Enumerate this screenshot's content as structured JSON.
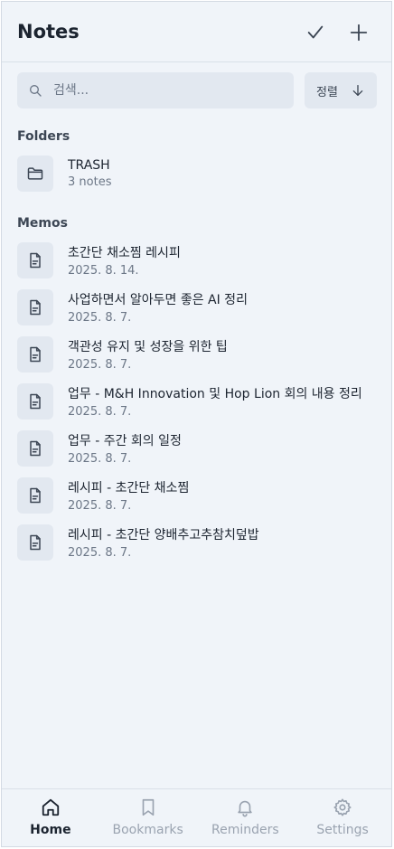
{
  "header": {
    "title": "Notes"
  },
  "search": {
    "placeholder": "검색..."
  },
  "sort": {
    "label": "정렬"
  },
  "folders": {
    "heading": "Folders",
    "items": [
      {
        "name": "TRASH",
        "count": "3 notes"
      }
    ]
  },
  "memos": {
    "heading": "Memos",
    "items": [
      {
        "title": "초간단 채소찜 레시피",
        "date": "2025. 8. 14."
      },
      {
        "title": "사업하면서 알아두면 좋은 AI 정리",
        "date": "2025. 8. 7."
      },
      {
        "title": "객관성 유지 및 성장을 위한 팁",
        "date": "2025. 8. 7."
      },
      {
        "title": "업무 - M&H Innovation 및 Hop Lion 회의 내용 정리",
        "date": "2025. 8. 7."
      },
      {
        "title": "업무 - 주간 회의 일정",
        "date": "2025. 8. 7."
      },
      {
        "title": "레시피 - 초간단 채소찜",
        "date": "2025. 8. 7."
      },
      {
        "title": "레시피 - 초간단 양배추고추참치덮밥",
        "date": "2025. 8. 7."
      }
    ]
  },
  "tabs": {
    "home": "Home",
    "bookmarks": "Bookmarks",
    "reminders": "Reminders",
    "settings": "Settings"
  },
  "colors": {
    "background": "#f0f4f9",
    "tile": "#e2e8f0",
    "text": "#1c2430",
    "muted": "#6c7787",
    "inactive_tab": "#9aa3b0"
  }
}
